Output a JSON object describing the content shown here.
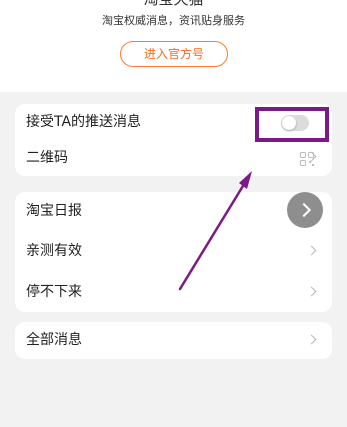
{
  "header": {
    "title_partial": "淘宝天猫",
    "subtitle": "淘宝权威消息，资讯贴身服务",
    "official_button_label": "进入官方号"
  },
  "settings": {
    "push_label": "接受TA的推送消息",
    "push_enabled": false,
    "qrcode_label": "二维码"
  },
  "subscriptions": [
    {
      "label": "淘宝日报"
    },
    {
      "label": "亲测有效"
    },
    {
      "label": "停不下来"
    }
  ],
  "all_messages_label": "全部消息",
  "colors": {
    "accent": "#ff6a14",
    "annotation": "#7b1a86",
    "page_bg": "#f2f2f2"
  },
  "icons": [
    "qrcode-icon",
    "chevron-right-icon",
    "toggle-switch"
  ]
}
